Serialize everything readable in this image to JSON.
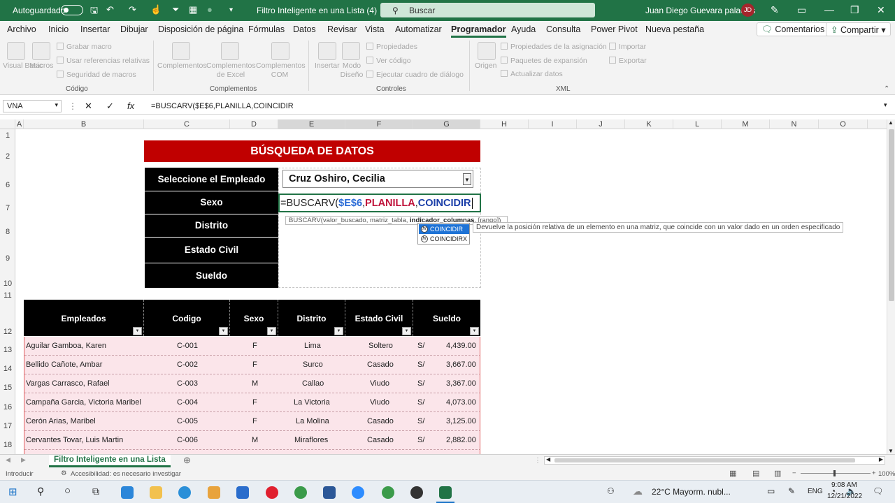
{
  "titlebar": {
    "autosave": "Autoguardado",
    "doc_title": "Filtro Inteligente en una Lista (4)",
    "search_placeholder": "Buscar",
    "user": "Juan Diego Guevara palacios",
    "initials": "JD"
  },
  "menu": {
    "items": [
      "Archivo",
      "Inicio",
      "Insertar",
      "Dibujar",
      "Disposición de página",
      "Fórmulas",
      "Datos",
      "Revisar",
      "Vista",
      "Automatizar",
      "Programador",
      "Ayuda",
      "Consulta",
      "Power Pivot",
      "Nueva pestaña"
    ],
    "active": "Programador",
    "comments": "Comentarios",
    "share": "Compartir"
  },
  "ribbon": {
    "codigo": {
      "visual_basic": "Visual Basic",
      "macros": "Macros",
      "grabar": "Grabar macro",
      "relativas": "Usar referencias relativas",
      "seguridad": "Seguridad de macros",
      "group": "Código"
    },
    "complementos": {
      "c1": "Complementos",
      "c2": "Complementos de Excel",
      "c3": "Complementos COM",
      "group": "Complementos"
    },
    "controles": {
      "insertar": "Insertar",
      "modo": "Modo Diseño",
      "propiedades": "Propiedades",
      "ver_codigo": "Ver código",
      "ejecutar": "Ejecutar cuadro de diálogo",
      "group": "Controles"
    },
    "xml": {
      "origen": "Origen",
      "prop_asig": "Propiedades de la asignación",
      "paquetes": "Paquetes de expansión",
      "actualizar": "Actualizar datos",
      "importar": "Importar",
      "exportar": "Exportar",
      "group": "XML"
    }
  },
  "formula_bar": {
    "name_box": "VNA",
    "formula": "=BUSCARV($E$6,PLANILLA,COINCIDIR"
  },
  "columns": [
    "A",
    "B",
    "C",
    "D",
    "E",
    "F",
    "G",
    "H",
    "I",
    "J",
    "K",
    "L",
    "M",
    "N",
    "O"
  ],
  "rows": [
    "1",
    "2",
    "6",
    "7",
    "8",
    "9",
    "10",
    "11",
    "12",
    "13",
    "14",
    "15",
    "16",
    "17",
    "18"
  ],
  "form": {
    "title": "BÚSQUEDA DE DATOS",
    "labels": [
      "Seleccione el Empleado",
      "Sexo",
      "Distrito",
      "Estado Civil",
      "Sueldo"
    ],
    "selected_employee": "Cruz Oshiro, Cecilia",
    "editing": {
      "fn": "=BUSCARV(",
      "ref": "$E$6",
      "sep1": ",",
      "range": "PLANILLA",
      "sep2": ",",
      "fn2": "COINCIDIR"
    },
    "tooltip_text": "BUSCARV(valor_buscado, matriz_tabla, ",
    "tooltip_bold": "indicador_columnas",
    "tooltip_tail": ", [rango])",
    "autocomplete": [
      "COINCIDIR",
      "COINCIDIRX"
    ],
    "ac_description": "Devuelve la posición relativa de un elemento en una matriz, que coincide con un valor dado en un orden especificado"
  },
  "table": {
    "headers": [
      "Empleados",
      "Codigo",
      "Sexo",
      "Distrito",
      "Estado Civil",
      "Sueldo"
    ],
    "currency": "S/",
    "rows": [
      {
        "name": "Aguilar Gamboa, Karen",
        "code": "C-001",
        "sex": "F",
        "district": "Lima",
        "civil": "Soltero",
        "salary": "4,439.00"
      },
      {
        "name": "Bellido Cañote, Ambar",
        "code": "C-002",
        "sex": "F",
        "district": "Surco",
        "civil": "Casado",
        "salary": "3,667.00"
      },
      {
        "name": "Vargas Carrasco, Rafael",
        "code": "C-003",
        "sex": "M",
        "district": "Callao",
        "civil": "Viudo",
        "salary": "3,367.00"
      },
      {
        "name": "Campaña Garcia, Victoria Maribel",
        "code": "C-004",
        "sex": "F",
        "district": "La Victoria",
        "civil": "Viudo",
        "salary": "4,073.00"
      },
      {
        "name": "Cerón Arias, Maribel",
        "code": "C-005",
        "sex": "F",
        "district": "La Molina",
        "civil": "Casado",
        "salary": "3,125.00"
      },
      {
        "name": "Cervantes Tovar, Luis Martin",
        "code": "C-006",
        "sex": "M",
        "district": "Miraflores",
        "civil": "Casado",
        "salary": "2,882.00"
      }
    ]
  },
  "sheet_tab": "Filtro Inteligente en una Lista",
  "status": {
    "mode": "Introducir",
    "accessibility": "Accesibilidad: es necesario investigar",
    "zoom": "100%"
  },
  "taskbar": {
    "weather": "22°C  Mayorm. nubl...",
    "lang": "ENG",
    "time": "9:08 AM",
    "date": "12/21/2022"
  },
  "colors": {
    "excel_green": "#217346",
    "banner_red": "#c00000",
    "row_pink": "#fbe5ea",
    "header_black": "#000000"
  }
}
